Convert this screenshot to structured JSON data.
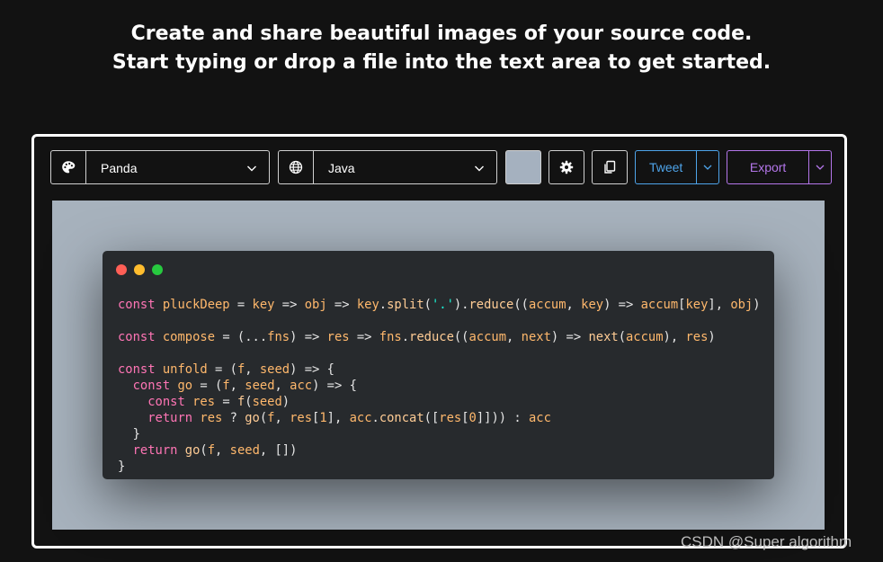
{
  "header": {
    "line1": "Create and share beautiful images of your source code.",
    "line2": "Start typing or drop a file into the text area to get started."
  },
  "toolbar": {
    "theme": {
      "icon": "palette-icon",
      "value": "Panda"
    },
    "language": {
      "icon": "globe-icon",
      "value": "Java"
    },
    "background_color": "#a5b1bf",
    "settings_icon": "gear-icon",
    "copy_icon": "copy-icon",
    "tweet_label": "Tweet",
    "export_label": "Export"
  },
  "window": {
    "controls": [
      "#ff5f56",
      "#ffbd2e",
      "#27c93f"
    ]
  },
  "code": {
    "lines": [
      [
        {
          "t": "const",
          "c": "kw"
        },
        {
          "t": " "
        },
        {
          "t": "pluckDeep",
          "c": "id"
        },
        {
          "t": " = "
        },
        {
          "t": "key",
          "c": "id"
        },
        {
          "t": " => "
        },
        {
          "t": "obj",
          "c": "id"
        },
        {
          "t": " => "
        },
        {
          "t": "key",
          "c": "id"
        },
        {
          "t": "."
        },
        {
          "t": "split",
          "c": "fn"
        },
        {
          "t": "("
        },
        {
          "t": "'.'",
          "c": "str"
        },
        {
          "t": ")."
        },
        {
          "t": "reduce",
          "c": "fn"
        },
        {
          "t": "(("
        },
        {
          "t": "accum",
          "c": "id"
        },
        {
          "t": ", "
        },
        {
          "t": "key",
          "c": "id"
        },
        {
          "t": ") => "
        },
        {
          "t": "accum",
          "c": "id"
        },
        {
          "t": "["
        },
        {
          "t": "key",
          "c": "id"
        },
        {
          "t": "], "
        },
        {
          "t": "obj",
          "c": "id"
        },
        {
          "t": ")"
        }
      ],
      [],
      [
        {
          "t": "const",
          "c": "kw"
        },
        {
          "t": " "
        },
        {
          "t": "compose",
          "c": "id"
        },
        {
          "t": " = (..."
        },
        {
          "t": "fns",
          "c": "id"
        },
        {
          "t": ") => "
        },
        {
          "t": "res",
          "c": "id"
        },
        {
          "t": " => "
        },
        {
          "t": "fns",
          "c": "id"
        },
        {
          "t": "."
        },
        {
          "t": "reduce",
          "c": "fn"
        },
        {
          "t": "(("
        },
        {
          "t": "accum",
          "c": "id"
        },
        {
          "t": ", "
        },
        {
          "t": "next",
          "c": "id"
        },
        {
          "t": ") => "
        },
        {
          "t": "next",
          "c": "fn"
        },
        {
          "t": "("
        },
        {
          "t": "accum",
          "c": "id"
        },
        {
          "t": "), "
        },
        {
          "t": "res",
          "c": "id"
        },
        {
          "t": ")"
        }
      ],
      [],
      [
        {
          "t": "const",
          "c": "kw"
        },
        {
          "t": " "
        },
        {
          "t": "unfold",
          "c": "id"
        },
        {
          "t": " = ("
        },
        {
          "t": "f",
          "c": "id"
        },
        {
          "t": ", "
        },
        {
          "t": "seed",
          "c": "id"
        },
        {
          "t": ") => {"
        }
      ],
      [
        {
          "t": "  "
        },
        {
          "t": "const",
          "c": "kw"
        },
        {
          "t": " "
        },
        {
          "t": "go",
          "c": "id"
        },
        {
          "t": " = ("
        },
        {
          "t": "f",
          "c": "id"
        },
        {
          "t": ", "
        },
        {
          "t": "seed",
          "c": "id"
        },
        {
          "t": ", "
        },
        {
          "t": "acc",
          "c": "id"
        },
        {
          "t": ") => {"
        }
      ],
      [
        {
          "t": "    "
        },
        {
          "t": "const",
          "c": "kw"
        },
        {
          "t": " "
        },
        {
          "t": "res",
          "c": "id"
        },
        {
          "t": " = "
        },
        {
          "t": "f",
          "c": "fn"
        },
        {
          "t": "("
        },
        {
          "t": "seed",
          "c": "id"
        },
        {
          "t": ")"
        }
      ],
      [
        {
          "t": "    "
        },
        {
          "t": "return",
          "c": "kw"
        },
        {
          "t": " "
        },
        {
          "t": "res",
          "c": "id"
        },
        {
          "t": " ? "
        },
        {
          "t": "go",
          "c": "fn"
        },
        {
          "t": "("
        },
        {
          "t": "f",
          "c": "id"
        },
        {
          "t": ", "
        },
        {
          "t": "res",
          "c": "id"
        },
        {
          "t": "["
        },
        {
          "t": "1",
          "c": "id"
        },
        {
          "t": "], "
        },
        {
          "t": "acc",
          "c": "id"
        },
        {
          "t": "."
        },
        {
          "t": "concat",
          "c": "fn"
        },
        {
          "t": "(["
        },
        {
          "t": "res",
          "c": "id"
        },
        {
          "t": "["
        },
        {
          "t": "0",
          "c": "id"
        },
        {
          "t": "]])) : "
        },
        {
          "t": "acc",
          "c": "id"
        }
      ],
      [
        {
          "t": "  }"
        }
      ],
      [
        {
          "t": "  "
        },
        {
          "t": "return",
          "c": "kw"
        },
        {
          "t": " "
        },
        {
          "t": "go",
          "c": "fn"
        },
        {
          "t": "("
        },
        {
          "t": "f",
          "c": "id"
        },
        {
          "t": ", "
        },
        {
          "t": "seed",
          "c": "id"
        },
        {
          "t": ", [])"
        }
      ],
      [
        {
          "t": "}"
        }
      ]
    ]
  },
  "watermark": "CSDN @Super algorithm"
}
